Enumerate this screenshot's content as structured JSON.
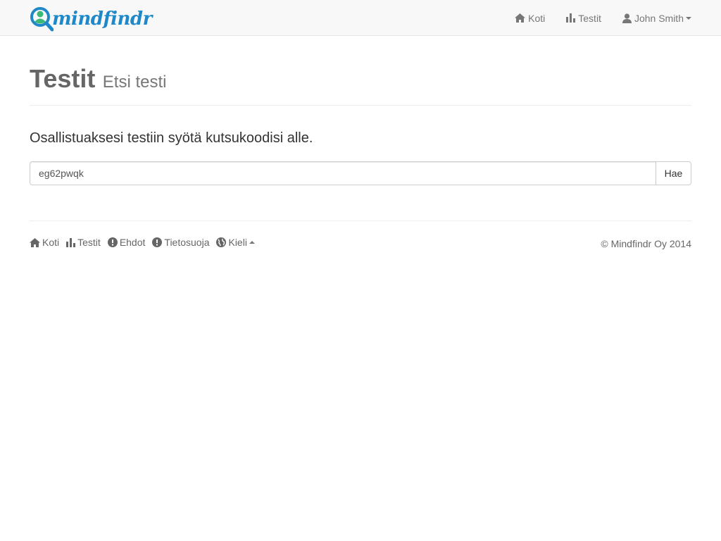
{
  "brand": {
    "name": "mindfindr",
    "color": "#1e88c8",
    "accent": "#3cb878"
  },
  "navbar": {
    "items": [
      {
        "label": "Koti",
        "icon": "home-icon"
      },
      {
        "label": "Testit",
        "icon": "bar-chart-icon"
      },
      {
        "label": "John Smith",
        "icon": "user-icon"
      }
    ]
  },
  "header": {
    "title": "Testit",
    "subtitle": "Etsi testi"
  },
  "main": {
    "lead": "Osallistuaksesi testiin syötä kutsukoodisi alle.",
    "input_value": "eg62pwqk",
    "button_label": "Hae"
  },
  "footer": {
    "links": [
      {
        "label": "Koti",
        "icon": "home-icon"
      },
      {
        "label": "Testit",
        "icon": "bar-chart-icon"
      },
      {
        "label": "Ehdot",
        "icon": "exclamation-icon"
      },
      {
        "label": "Tietosuoja",
        "icon": "exclamation-icon"
      },
      {
        "label": "Kieli",
        "icon": "globe-icon"
      }
    ],
    "copyright": "© Mindfindr Oy 2014"
  }
}
